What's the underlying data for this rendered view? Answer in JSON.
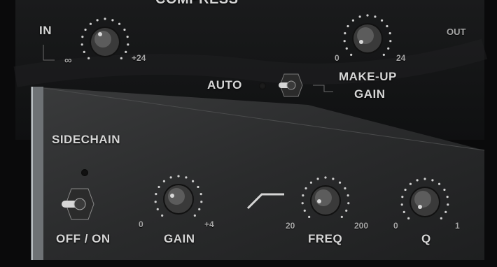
{
  "header": {
    "title_partial": "COMPRESS"
  },
  "compressor": {
    "in_label": "IN",
    "out_label": "OUT",
    "threshold_knob": {
      "min_label": "∞",
      "max_label": "+24"
    },
    "makeup_knob": {
      "min_label": "0",
      "max_label": "24"
    },
    "auto_label": "AUTO",
    "makeup_label_line1": "MAKE-UP",
    "makeup_label_line2": "GAIN"
  },
  "sidechain": {
    "title": "SIDECHAIN",
    "toggle_label": "OFF / ON",
    "gain": {
      "label": "GAIN",
      "min_label": "0",
      "max_label": "+4"
    },
    "freq": {
      "label": "FREQ",
      "min_label": "20",
      "max_label": "200"
    },
    "q": {
      "label": "Q",
      "min_label": "0",
      "max_label": "1"
    },
    "filter_icon": "high-pass-filter-icon"
  },
  "colors": {
    "panel_dark": "#151617",
    "panel_light": "#2f3031",
    "label": "#d6d6d6",
    "scale": "#a7a7a7"
  }
}
